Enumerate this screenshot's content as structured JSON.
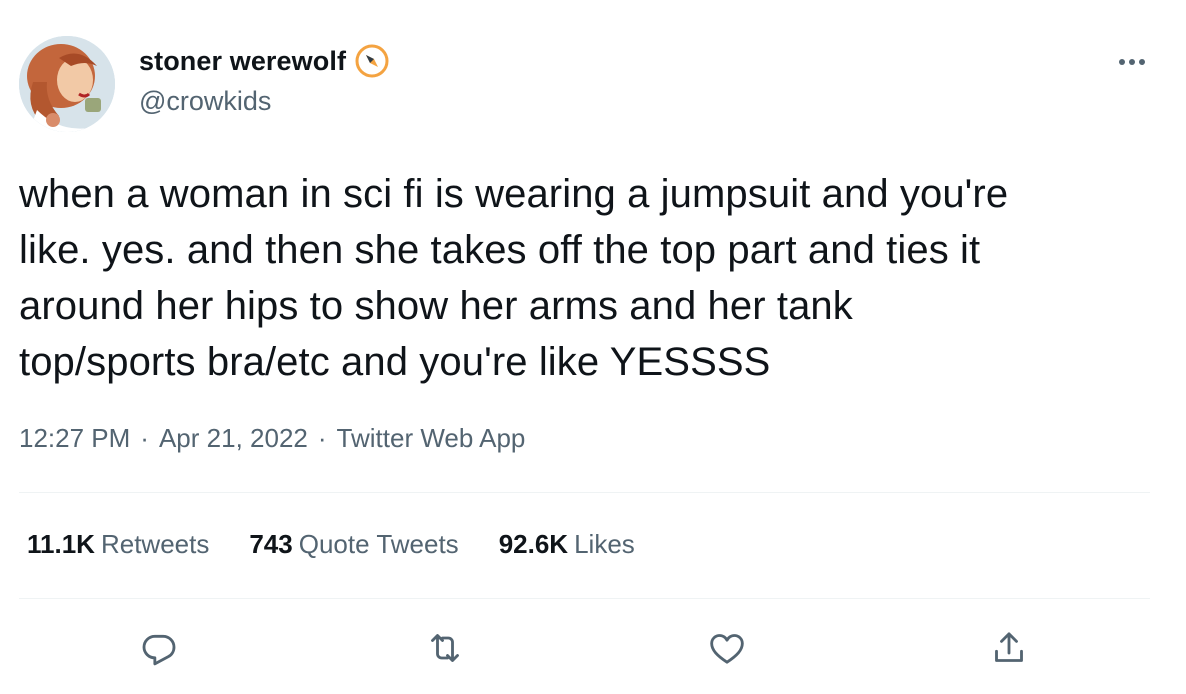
{
  "author": {
    "display_name": "stoner werewolf",
    "handle": "@crowkids",
    "badge_icon": "compass-icon",
    "avatar_icon": "avatar-illustration"
  },
  "menu_icon": "more-options-icon",
  "tweet": {
    "lines": [
      "when a woman in sci fi is wearing a jumpsuit and you're",
      "like. yes. and then she takes off the top part and ties it",
      "around her hips to show her arms and her tank",
      "top/sports bra/etc and you're like YESSSS"
    ],
    "time": "12:27 PM",
    "date": "Apr 21, 2022",
    "source": "Twitter Web App",
    "separator": "·"
  },
  "stats": {
    "retweets": {
      "count": "11.1K",
      "label": "Retweets"
    },
    "quotes": {
      "count": "743",
      "label": "Quote Tweets"
    },
    "likes": {
      "count": "92.6K",
      "label": "Likes"
    }
  },
  "actions": [
    "reply-icon",
    "retweet-icon",
    "like-icon",
    "share-icon"
  ],
  "colors": {
    "text": "#0f1419",
    "secondary_text": "#536471",
    "divider": "#eff3f4",
    "badge": "#f4a341"
  }
}
